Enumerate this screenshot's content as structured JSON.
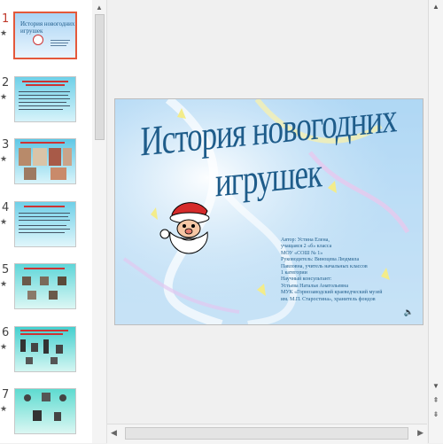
{
  "thumbnails": [
    {
      "number": "1",
      "star": "★",
      "selected": true
    },
    {
      "number": "2",
      "star": "★",
      "selected": false
    },
    {
      "number": "3",
      "star": "★",
      "selected": false
    },
    {
      "number": "4",
      "star": "★",
      "selected": false
    },
    {
      "number": "5",
      "star": "★",
      "selected": false
    },
    {
      "number": "6",
      "star": "★",
      "selected": false
    },
    {
      "number": "7",
      "star": "★",
      "selected": false
    }
  ],
  "slide": {
    "title": "История новогодних игрушек",
    "info_lines": [
      "Автор: Устина Елена,",
      "учащаяся 2 «б» класса",
      "МОУ «СОШ № 1»",
      "Руководитель: Виноцева Людмила",
      "Павловна, учитель начальных классов",
      "1 категории",
      "Научный консультант:",
      "Устьева Наталья Анатольевна",
      "МУК «Горнозаводский краеведческий музей",
      "им. М.П. Старостина», хранитель фондов"
    ]
  },
  "colors": {
    "selected_border": "#e4593b",
    "title_color": "#1e5c8a",
    "slide_number_active": "#c0392b"
  }
}
